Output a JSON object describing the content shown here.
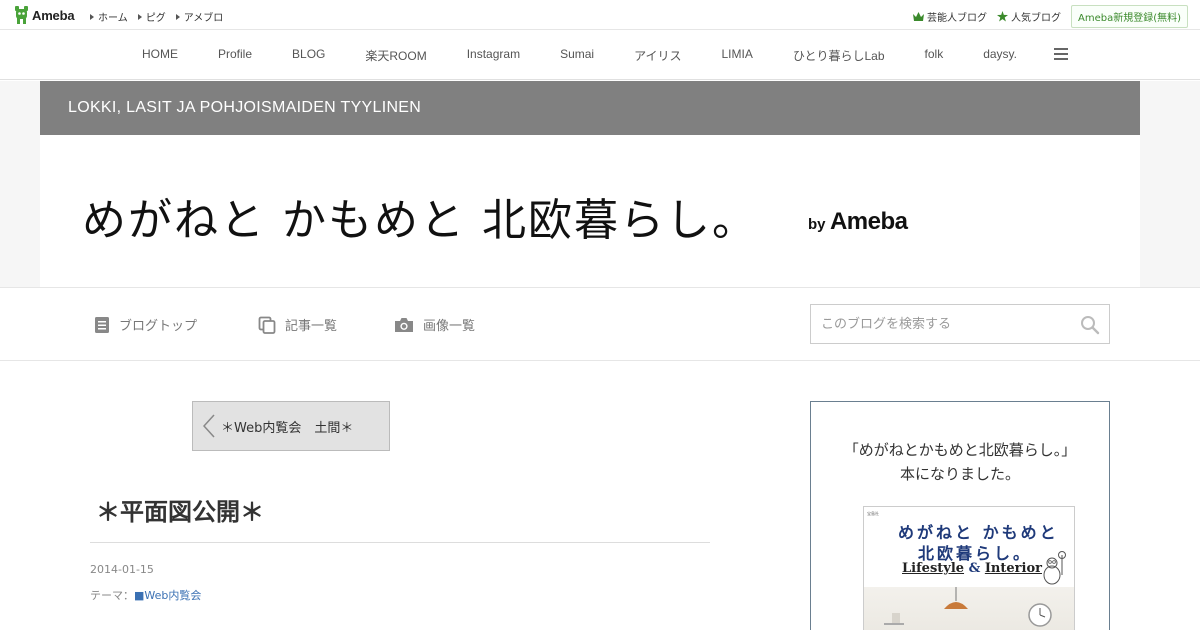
{
  "topbar": {
    "logo_text": "Ameba",
    "links": [
      "ホーム",
      "ピグ",
      "アメブロ"
    ],
    "right_links": [
      "芸能人ブログ",
      "人気ブログ"
    ],
    "register_label": "Ameba新規登録(無料)"
  },
  "blognav": {
    "items": [
      "HOME",
      "Profile",
      "BLOG",
      "楽天ROOM",
      "Instagram",
      "Sumai",
      "アイリス",
      "LIMIA",
      "ひとり暮らしLab",
      "folk",
      "daysy."
    ]
  },
  "header": {
    "banner_text": "LOKKI, LASIT JA POHJOISMAIDEN TYYLINEN",
    "blog_title": "めがねと かもめと 北欧暮らし。",
    "by": "by",
    "ameba": "Ameba"
  },
  "subnav": {
    "blog_top": "ブログトップ",
    "entry_list": "記事一覧",
    "image_list": "画像一覧",
    "search_placeholder": "このブログを検索する"
  },
  "main": {
    "prev_entry_label": "＊Web内覧会　土間＊",
    "entry_title": "＊平面図公開＊",
    "entry_date": "2014-01-15",
    "theme_prefix": "テーマ：",
    "theme_link": "■Web内覧会"
  },
  "sidebar": {
    "heading_line1": "「めがねとかもめと北欧暮らし。」",
    "heading_line2": "本になりました。",
    "book": {
      "title_line1": "めがねと かもめと",
      "title_line2": "北欧暮らし。",
      "sub_lifestyle": "Lifestyle",
      "sub_amp": "&",
      "sub_interior": "Interior",
      "small_text": "宝島社"
    }
  },
  "colors": {
    "banner": "#808080",
    "ameba_green": "#3b8a2c",
    "link_blue": "#3a70b3",
    "book_navy": "#1f3a7a"
  }
}
